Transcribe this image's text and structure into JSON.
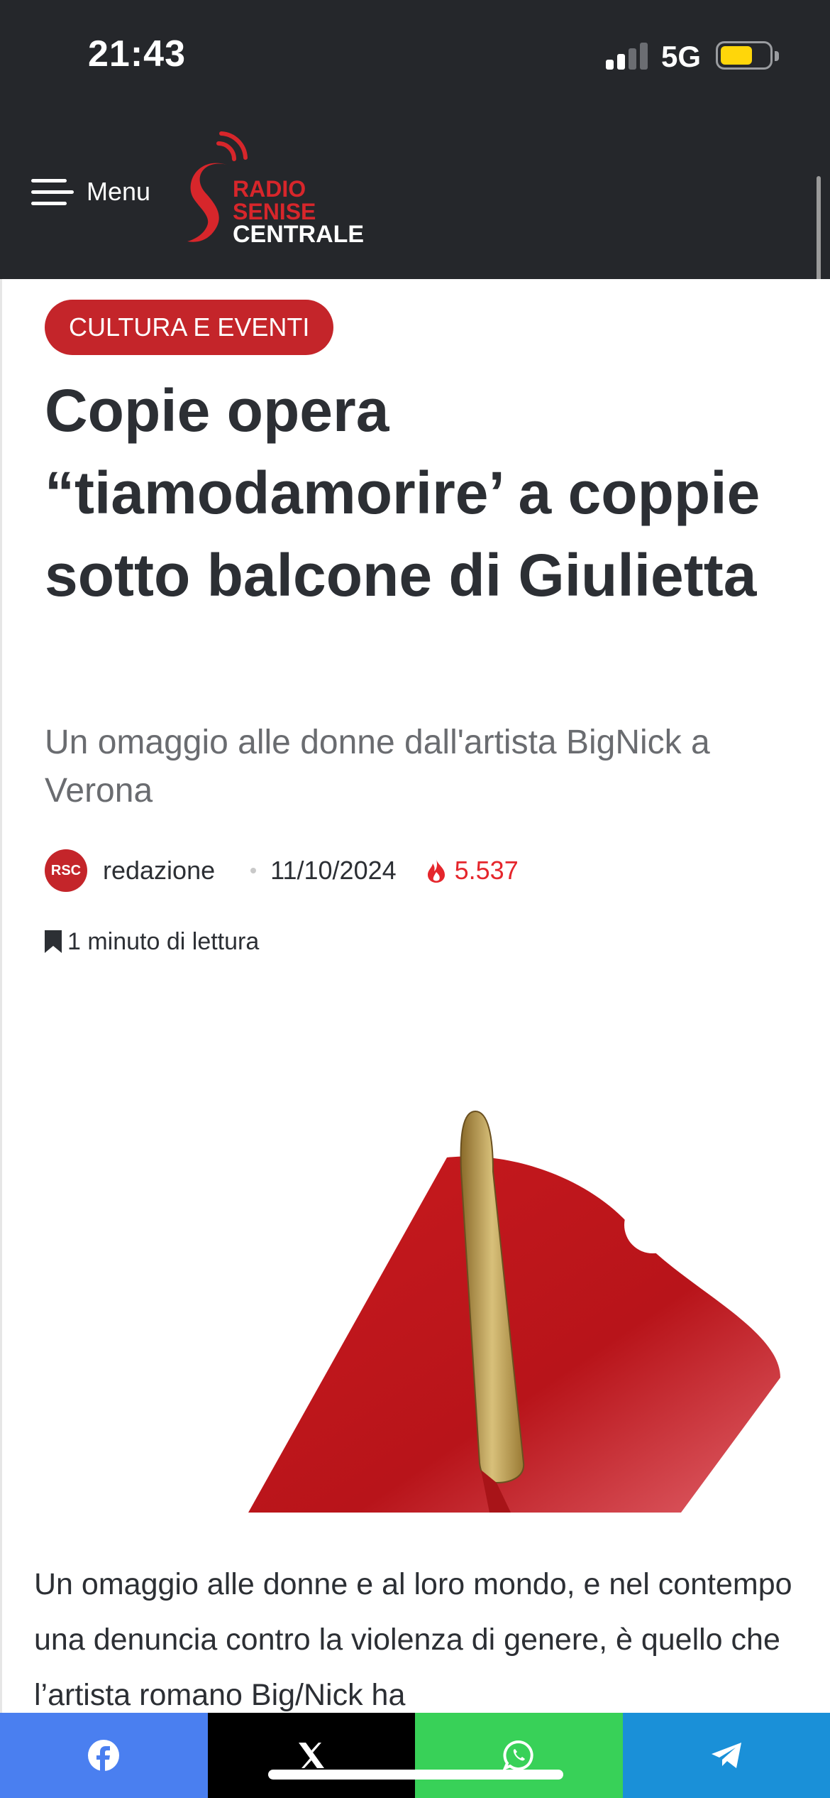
{
  "status_bar": {
    "time": "21:43",
    "network": "5G",
    "battery_color": "#ffd60a"
  },
  "header": {
    "menu_label": "Menu",
    "menu_icon": "hamburger-icon",
    "logo": {
      "line1": "RADIO",
      "line2": "SENISE",
      "line3": "CENTRALE",
      "brand_color": "#d7262b"
    }
  },
  "article": {
    "category": "CULTURA E EVENTI",
    "title": "Copie opera “tiamodamorire’ a coppie sotto balcone di Giulietta",
    "subtitle": "Un omaggio alle donne dall'artista BigNick a Verona",
    "meta": {
      "avatar_text": "RSC",
      "author": "redazione",
      "date": "11/10/2024",
      "views": "5.537",
      "views_icon": "fire-icon"
    },
    "read_time": "1 minuto di lettura",
    "read_time_icon": "bookmark-icon",
    "body": "Un omaggio alle donne e al loro mondo, e nel contempo una denuncia contro la violenza di genere, è quello che l’artista romano Big/Nick ha"
  },
  "share_bar": {
    "buttons": [
      {
        "network": "facebook",
        "icon": "facebook-icon",
        "color": "#4a7ff0"
      },
      {
        "network": "x",
        "icon": "x-icon",
        "color": "#000000"
      },
      {
        "network": "whatsapp",
        "icon": "whatsapp-icon",
        "color": "#38d158"
      },
      {
        "network": "telegram",
        "icon": "telegram-icon",
        "color": "#1a90d8"
      }
    ]
  },
  "colors": {
    "header_bg": "#25272b",
    "accent": "#c4252a"
  }
}
